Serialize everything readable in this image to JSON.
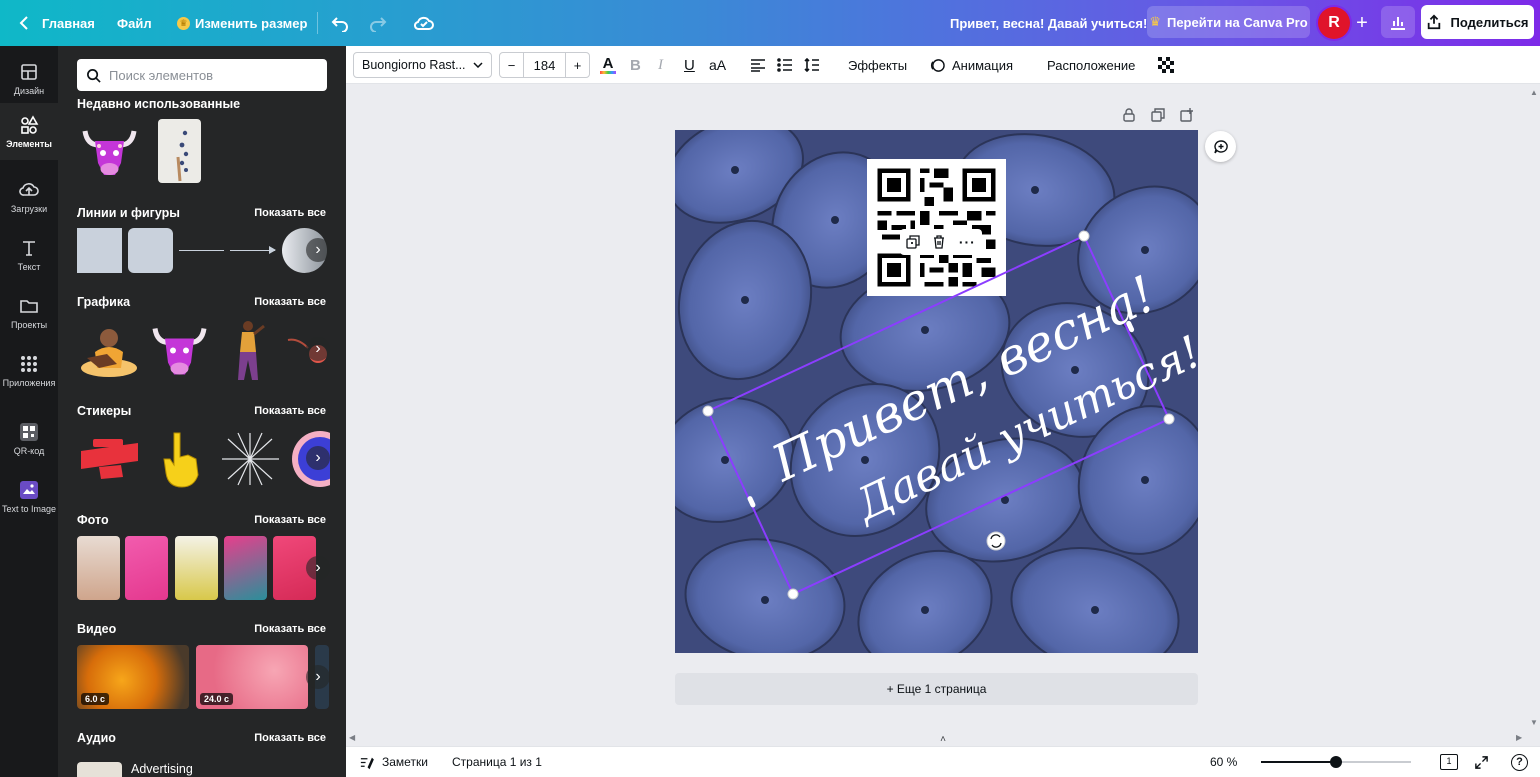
{
  "topbar": {
    "home_label": "Главная",
    "file_label": "Файл",
    "resize_label": "Изменить размер",
    "design_title": "Привет, весна! Давай учиться!",
    "upgrade_label": "Перейти на Canva Pro",
    "avatar_initial": "R",
    "add_label": "+",
    "share_label": "Поделиться"
  },
  "rail": {
    "items": [
      {
        "label": "Дизайн",
        "icon": "layout-icon"
      },
      {
        "label": "Элементы",
        "icon": "shapes-icon"
      },
      {
        "label": "Загрузки",
        "icon": "cloud-upload-icon"
      },
      {
        "label": "Текст",
        "icon": "text-icon"
      },
      {
        "label": "Проекты",
        "icon": "folder-icon"
      },
      {
        "label": "Приложения",
        "icon": "apps-grid-icon"
      },
      {
        "label": "QR-код",
        "icon": "qr-code-icon"
      },
      {
        "label": "Text to Image",
        "icon": "text-to-image-icon"
      }
    ]
  },
  "panel": {
    "search_placeholder": "Поиск элементов",
    "show_all": "Показать все",
    "recent_title": "Недавно использованные",
    "shapes_title": "Линии и фигуры",
    "graphics_title": "Графика",
    "stickers_title": "Стикеры",
    "photos_title": "Фото",
    "video_title": "Видео",
    "audio_title": "Аудио",
    "video_durations": [
      "6.0 с",
      "24.0 с"
    ],
    "audio_track": "Advertising"
  },
  "toolbar": {
    "font": "Buongiorno Rast...",
    "size_minus": "−",
    "size": "184",
    "size_plus": "+",
    "effects": "Эффекты",
    "animation": "Анимация",
    "position": "Расположение"
  },
  "canvas": {
    "script_line1": "Привет, весна!",
    "script_line2": "Давай учиться!",
    "add_page": "+ Еще 1 страница"
  },
  "footer": {
    "notes": "Заметки",
    "page_info": "Страница 1 из 1",
    "zoom": "60 %",
    "zoom_fraction": 0.5,
    "page_count": "1",
    "help": "?"
  },
  "colors": {
    "accent": "#7d2ae8",
    "gradient_start": "#0fb8c8",
    "selection": "#8b3dff",
    "avatar": "#e0142a"
  }
}
